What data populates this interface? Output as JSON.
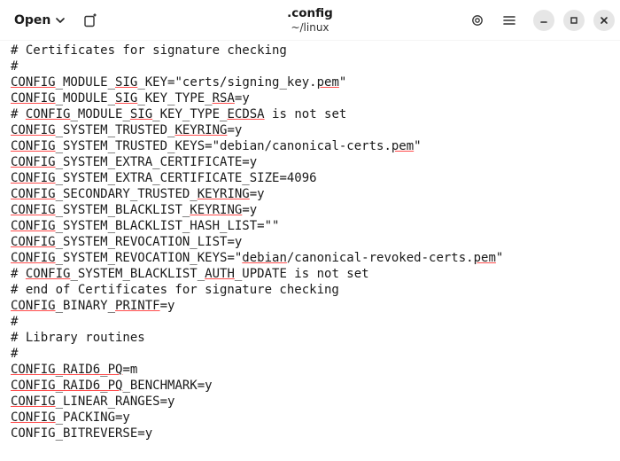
{
  "header": {
    "open_label": "Open",
    "title": ".config",
    "subtitle": "~/linux"
  },
  "lines": [
    {
      "segs": [
        {
          "t": "# Certificates for signature checking"
        }
      ]
    },
    {
      "segs": [
        {
          "t": "#"
        }
      ]
    },
    {
      "segs": [
        {
          "t": "CONFIG",
          "u": 1
        },
        {
          "t": "_MODULE_"
        },
        {
          "t": "SIG",
          "u": 1
        },
        {
          "t": "_KEY=\"certs/signing_key."
        },
        {
          "t": "pem",
          "u": 1
        },
        {
          "t": "\""
        }
      ]
    },
    {
      "segs": [
        {
          "t": "CONFIG",
          "u": 1
        },
        {
          "t": "_MODULE_"
        },
        {
          "t": "SIG",
          "u": 1
        },
        {
          "t": "_KEY_TYPE_"
        },
        {
          "t": "RSA",
          "u": 1
        },
        {
          "t": "=y"
        }
      ]
    },
    {
      "segs": [
        {
          "t": "# "
        },
        {
          "t": "CONFIG",
          "u": 1
        },
        {
          "t": "_MODULE_"
        },
        {
          "t": "SIG",
          "u": 1
        },
        {
          "t": "_KEY_TYPE_"
        },
        {
          "t": "ECDSA",
          "u": 1
        },
        {
          "t": " is not set"
        }
      ]
    },
    {
      "segs": [
        {
          "t": "CONFIG",
          "u": 1
        },
        {
          "t": "_SYSTEM_TRUSTED_"
        },
        {
          "t": "KEYRING",
          "u": 1
        },
        {
          "t": "=y"
        }
      ]
    },
    {
      "segs": [
        {
          "t": "CONFIG",
          "u": 1
        },
        {
          "t": "_SYSTEM_TRUSTED_KEYS=\"debian/canonical-certs."
        },
        {
          "t": "pem",
          "u": 1
        },
        {
          "t": "\""
        }
      ]
    },
    {
      "segs": [
        {
          "t": "CONFIG",
          "u": 1
        },
        {
          "t": "_SYSTEM_EXTRA_CERTIFICATE=y"
        }
      ]
    },
    {
      "segs": [
        {
          "t": "CONFIG",
          "u": 1
        },
        {
          "t": "_SYSTEM_EXTRA_CERTIFICATE_SIZE=4096"
        }
      ]
    },
    {
      "segs": [
        {
          "t": "CONFIG",
          "u": 1
        },
        {
          "t": "_SECONDARY_TRUSTED_"
        },
        {
          "t": "KEYRING",
          "u": 1
        },
        {
          "t": "=y"
        }
      ]
    },
    {
      "segs": [
        {
          "t": "CONFIG",
          "u": 1
        },
        {
          "t": "_SYSTEM_BLACKLIST_"
        },
        {
          "t": "KEYRING",
          "u": 1
        },
        {
          "t": "=y"
        }
      ]
    },
    {
      "segs": [
        {
          "t": "CONFIG",
          "u": 1
        },
        {
          "t": "_SYSTEM_BLACKLIST_HASH_LIST=\"\""
        }
      ]
    },
    {
      "segs": [
        {
          "t": "CONFIG",
          "u": 1
        },
        {
          "t": "_SYSTEM_REVOCATION_LIST=y"
        }
      ]
    },
    {
      "segs": [
        {
          "t": "CONFIG",
          "u": 1
        },
        {
          "t": "_SYSTEM_REVOCATION_KEYS=\""
        },
        {
          "t": "debian",
          "u": 1
        },
        {
          "t": "/canonical-revoked-certs."
        },
        {
          "t": "pem",
          "u": 1
        },
        {
          "t": "\""
        }
      ]
    },
    {
      "segs": [
        {
          "t": "# "
        },
        {
          "t": "CONFIG",
          "u": 1
        },
        {
          "t": "_SYSTEM_BLACKLIST_"
        },
        {
          "t": "AUTH",
          "u": 1
        },
        {
          "t": "_UPDATE is not set"
        }
      ]
    },
    {
      "segs": [
        {
          "t": "# end of Certificates for signature checking"
        }
      ]
    },
    {
      "segs": [
        {
          "t": ""
        }
      ]
    },
    {
      "segs": [
        {
          "t": "CONFIG",
          "u": 1
        },
        {
          "t": "_BINARY_"
        },
        {
          "t": "PRINTF",
          "u": 1
        },
        {
          "t": "=y"
        }
      ]
    },
    {
      "segs": [
        {
          "t": ""
        }
      ]
    },
    {
      "segs": [
        {
          "t": "#"
        }
      ]
    },
    {
      "segs": [
        {
          "t": "# Library routines"
        }
      ]
    },
    {
      "segs": [
        {
          "t": "#"
        }
      ]
    },
    {
      "segs": [
        {
          "t": "CONFIG_RAID6_PQ",
          "u": 1
        },
        {
          "t": "=m"
        }
      ]
    },
    {
      "segs": [
        {
          "t": "CONFIG_RAID6_PQ",
          "u": 1
        },
        {
          "t": "_BENCHMARK=y"
        }
      ]
    },
    {
      "segs": [
        {
          "t": "CONFIG",
          "u": 1
        },
        {
          "t": "_LINEAR_RANGES=y"
        }
      ]
    },
    {
      "segs": [
        {
          "t": "CONFIG",
          "u": 1
        },
        {
          "t": "_PACKING=y"
        }
      ]
    },
    {
      "segs": [
        {
          "t": "CONFIG_BITREVERSE=y"
        }
      ]
    }
  ]
}
